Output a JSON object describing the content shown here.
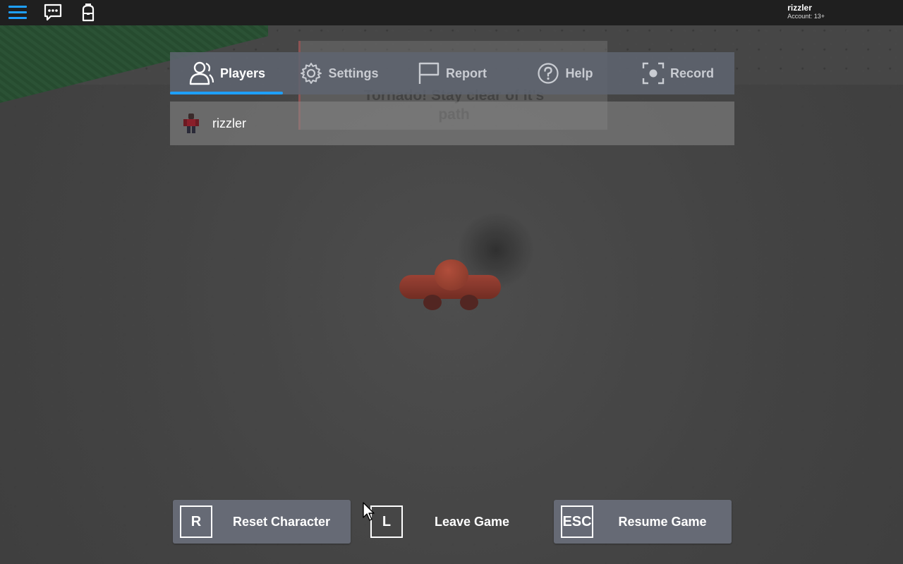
{
  "topbar": {
    "account_name": "rizzler",
    "account_age": "Account: 13+",
    "accent_color": "#1ea0ff"
  },
  "world": {
    "notice_text_line1": "Tornado! Stay clear of it's",
    "notice_text_line2": "path"
  },
  "tabs": [
    {
      "label": "Players",
      "icon": "players-icon",
      "active": true
    },
    {
      "label": "Settings",
      "icon": "gear-icon",
      "active": false
    },
    {
      "label": "Report",
      "icon": "flag-icon",
      "active": false
    },
    {
      "label": "Help",
      "icon": "help-icon",
      "active": false
    },
    {
      "label": "Record",
      "icon": "record-icon",
      "active": false
    }
  ],
  "players": [
    {
      "name": "rizzler"
    }
  ],
  "actions": {
    "reset": {
      "key": "R",
      "label": "Reset Character"
    },
    "leave": {
      "key": "L",
      "label": "Leave Game"
    },
    "resume": {
      "key": "ESC",
      "label": "Resume Game"
    }
  }
}
